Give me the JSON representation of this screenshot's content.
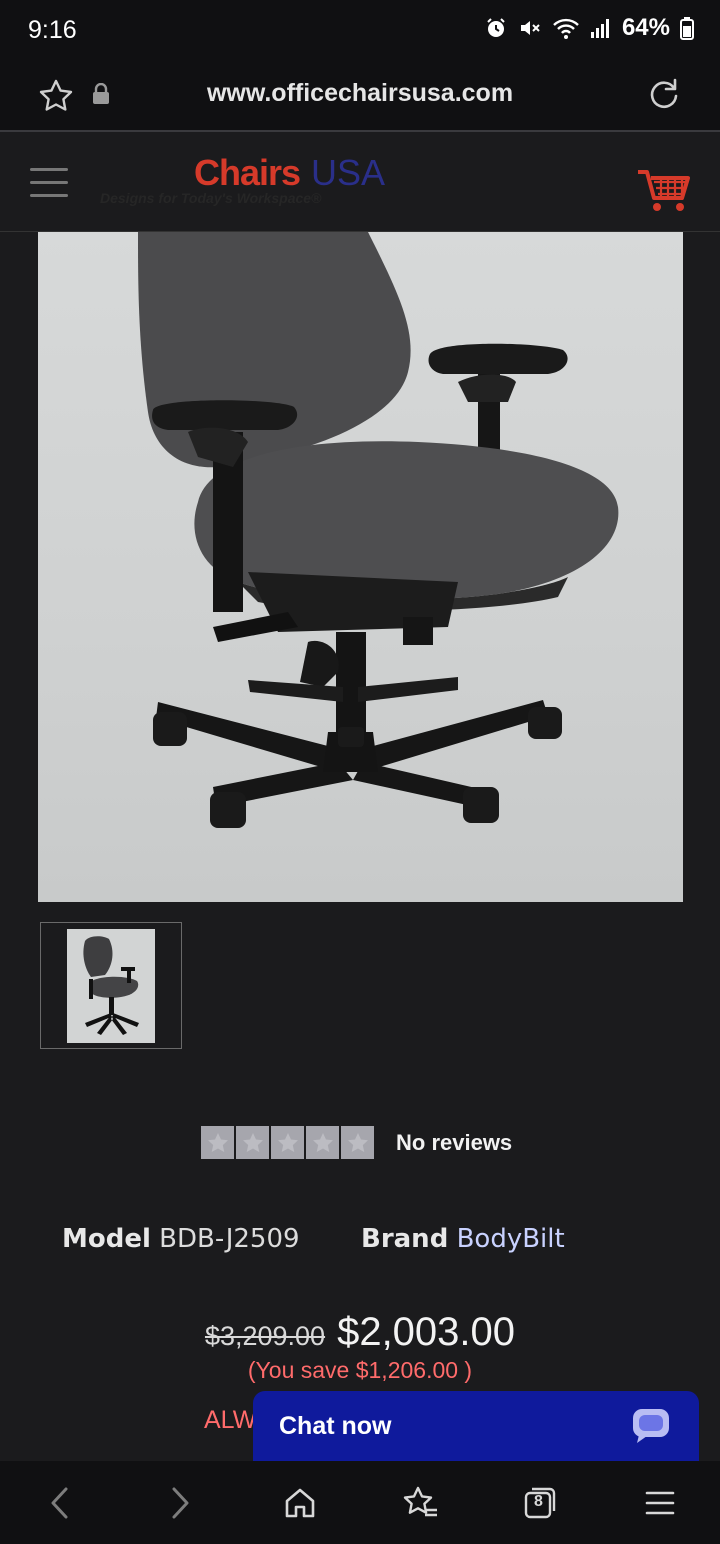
{
  "status_bar": {
    "time": "9:16",
    "battery": "64%",
    "icons": [
      "alarm-icon",
      "mute-icon",
      "wifi-icon",
      "signal-icon",
      "battery-icon"
    ]
  },
  "browser": {
    "url": "www.officechairsusa.com",
    "icons": [
      "star-icon",
      "lock-icon",
      "reload-icon"
    ]
  },
  "site_header": {
    "logo_brand": "Chairs",
    "logo_usa": "USA",
    "logo_tagline": "Designs for Today's Workspace®",
    "icons": [
      "hamburger-menu-icon",
      "cart-icon"
    ]
  },
  "product": {
    "reviews_text": "No reviews",
    "star_count": 5,
    "model_label": "Model",
    "model_value": "BDB-J2509",
    "brand_label": "Brand",
    "brand_value": "BodyBilt",
    "old_price": "$3,209.00",
    "new_price": "$2,003.00",
    "savings": "(You save $1,206.00 )",
    "always_prefix": "ALW"
  },
  "chat": {
    "label": "Chat now"
  },
  "bottom_nav": {
    "tab_count": "8",
    "icons": [
      "back-icon",
      "forward-icon",
      "home-icon",
      "bookmarks-icon",
      "tabs-icon",
      "menu-icon"
    ]
  },
  "colors": {
    "background": "#1b1b1d",
    "bar_background": "#101012",
    "logo_red": "#d63a2a",
    "logo_blue": "#2a2f8a",
    "sale_red": "#ff6b6b",
    "chat_blue": "#0f1a9c",
    "brand_link": "#c9d2ff"
  }
}
